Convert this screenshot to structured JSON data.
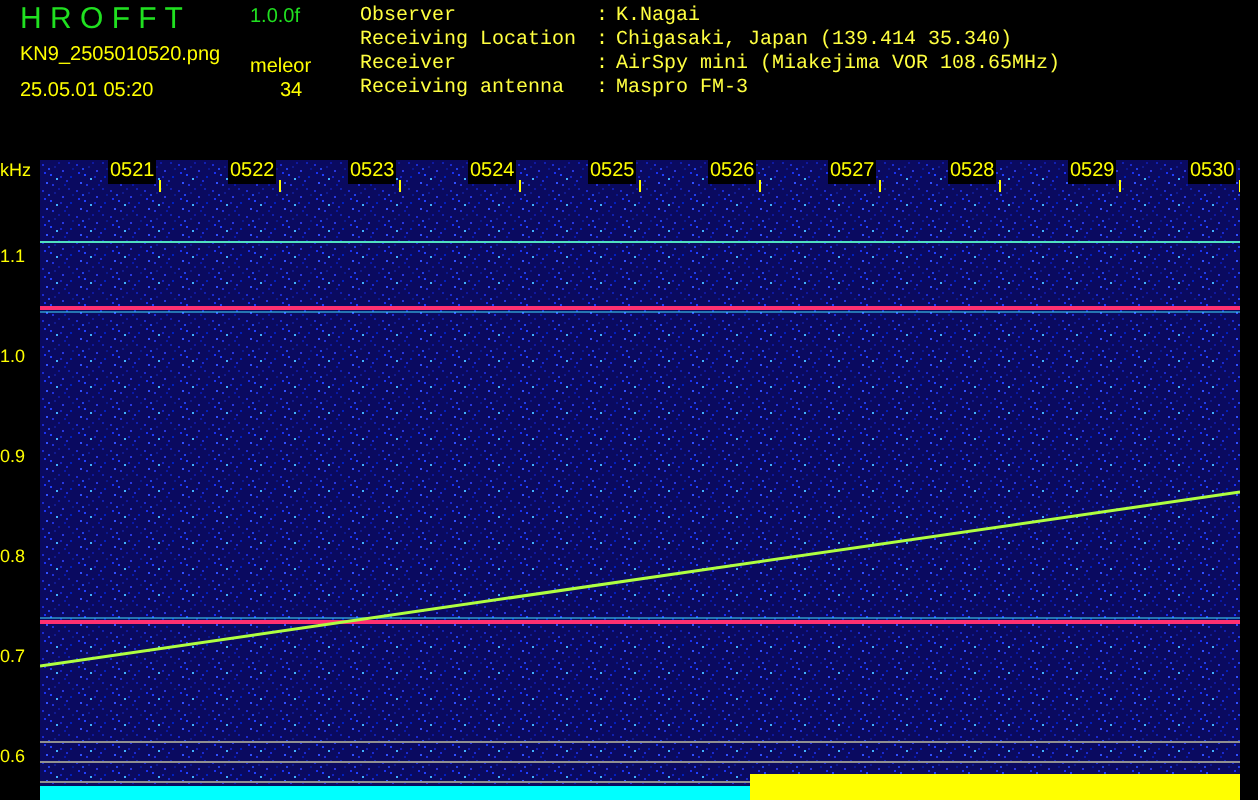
{
  "header": {
    "title": "H R O F F T",
    "version": "1.0.0f",
    "filename": "KN9_2505010520.png",
    "mode": "meleor",
    "datetime": "25.05.01 05:20",
    "count": "34"
  },
  "info": [
    {
      "label": "Observer",
      "separator": ":",
      "value": "K.Nagai"
    },
    {
      "label": "Receiving Location",
      "separator": ":",
      "value": "Chigasaki, Japan (139.414 35.340)"
    },
    {
      "label": "Receiver",
      "separator": ":",
      "value": "AirSpy mini (Miakejima VOR 108.65MHz)"
    },
    {
      "label": "Receiving antenna",
      "separator": ":",
      "value": "Maspro FM-3"
    }
  ],
  "spectrogram": {
    "y_unit": "kHz",
    "y_labels": [
      "1.1",
      "1.0",
      "0.9",
      "0.8",
      "0.7",
      "0.6"
    ],
    "x_labels": [
      "0521",
      "0522",
      "0523",
      "0524",
      "0525",
      "0526",
      "0527",
      "0528",
      "0529",
      "0530"
    ]
  }
}
